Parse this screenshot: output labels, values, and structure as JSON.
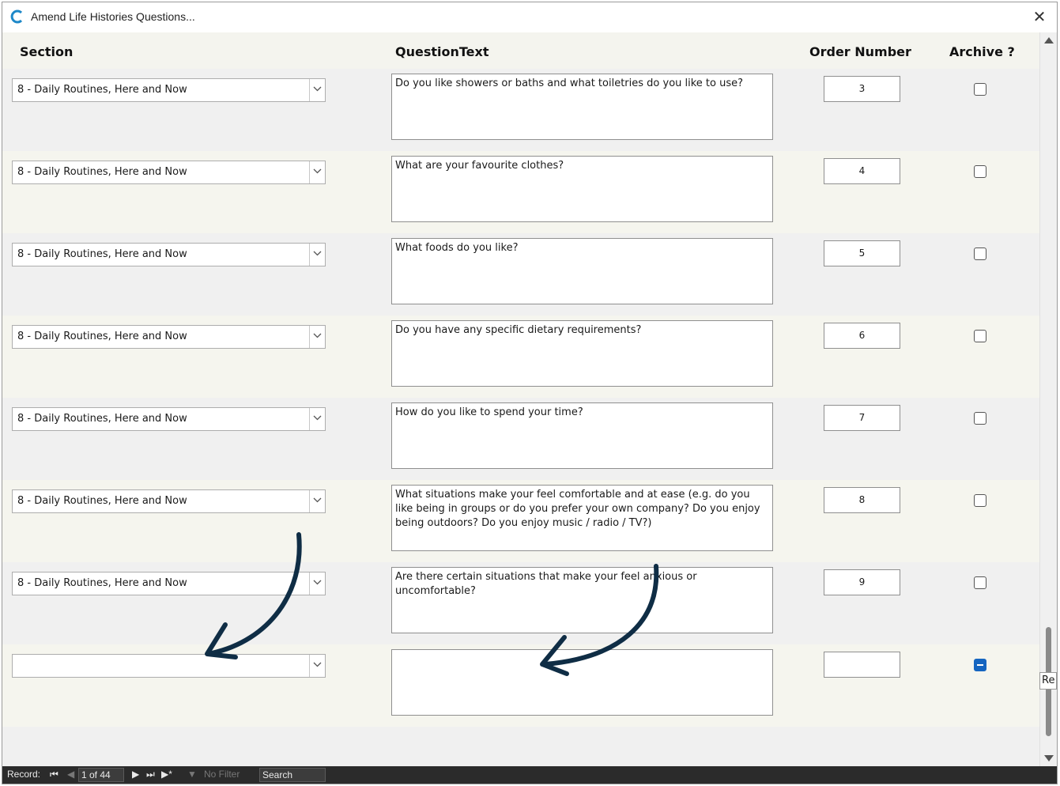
{
  "window": {
    "title": "Amend Life Histories Questions...",
    "close_label": "✕"
  },
  "headers": {
    "section": "Section",
    "question_text": "QuestionText",
    "order_number": "Order Number",
    "archive": "Archive ?"
  },
  "rows": [
    {
      "section": "8 - Daily Routines, Here and Now",
      "question": "Do you like showers or baths and what toiletries do you like to use?",
      "order": "3",
      "archived": false
    },
    {
      "section": "8 - Daily Routines, Here and Now",
      "question": "What are your favourite clothes?",
      "order": "4",
      "archived": false
    },
    {
      "section": "8 - Daily Routines, Here and Now",
      "question": "What foods do you like?",
      "order": "5",
      "archived": false
    },
    {
      "section": "8 - Daily Routines, Here and Now",
      "question": "Do you have any specific dietary requirements?",
      "order": "6",
      "archived": false
    },
    {
      "section": "8 - Daily Routines, Here and Now",
      "question": "How do you like to spend your time?",
      "order": "7",
      "archived": false
    },
    {
      "section": "8 - Daily Routines, Here and Now",
      "question": "What situations make your feel comfortable and at ease (e.g. do you like being in groups or do you prefer your own company? Do you enjoy being outdoors? Do you enjoy music / radio / TV?)",
      "order": "8",
      "archived": false
    },
    {
      "section": "8 - Daily Routines, Here and Now",
      "question": "Are there certain situations that make your feel anxious or uncomfortable?",
      "order": "9",
      "archived": false
    },
    {
      "section": "",
      "question": "",
      "order": "",
      "archived": "indeterminate"
    }
  ],
  "scrollbar": {
    "tooltip": "Re"
  },
  "navigation": {
    "record_label": "Record:",
    "first_icon": "first-record-icon",
    "prev_icon": "previous-record-icon",
    "position": "1 of 44",
    "next_icon": "next-record-icon",
    "last_icon": "last-record-icon",
    "new_icon": "new-record-icon",
    "filter_label": "No Filter",
    "search_placeholder": "Search"
  },
  "colors": {
    "annotation_arrow": "#0f2d45",
    "checkbox_indeterminate": "#1565c0",
    "navbar_bg": "#2b2b2b"
  }
}
